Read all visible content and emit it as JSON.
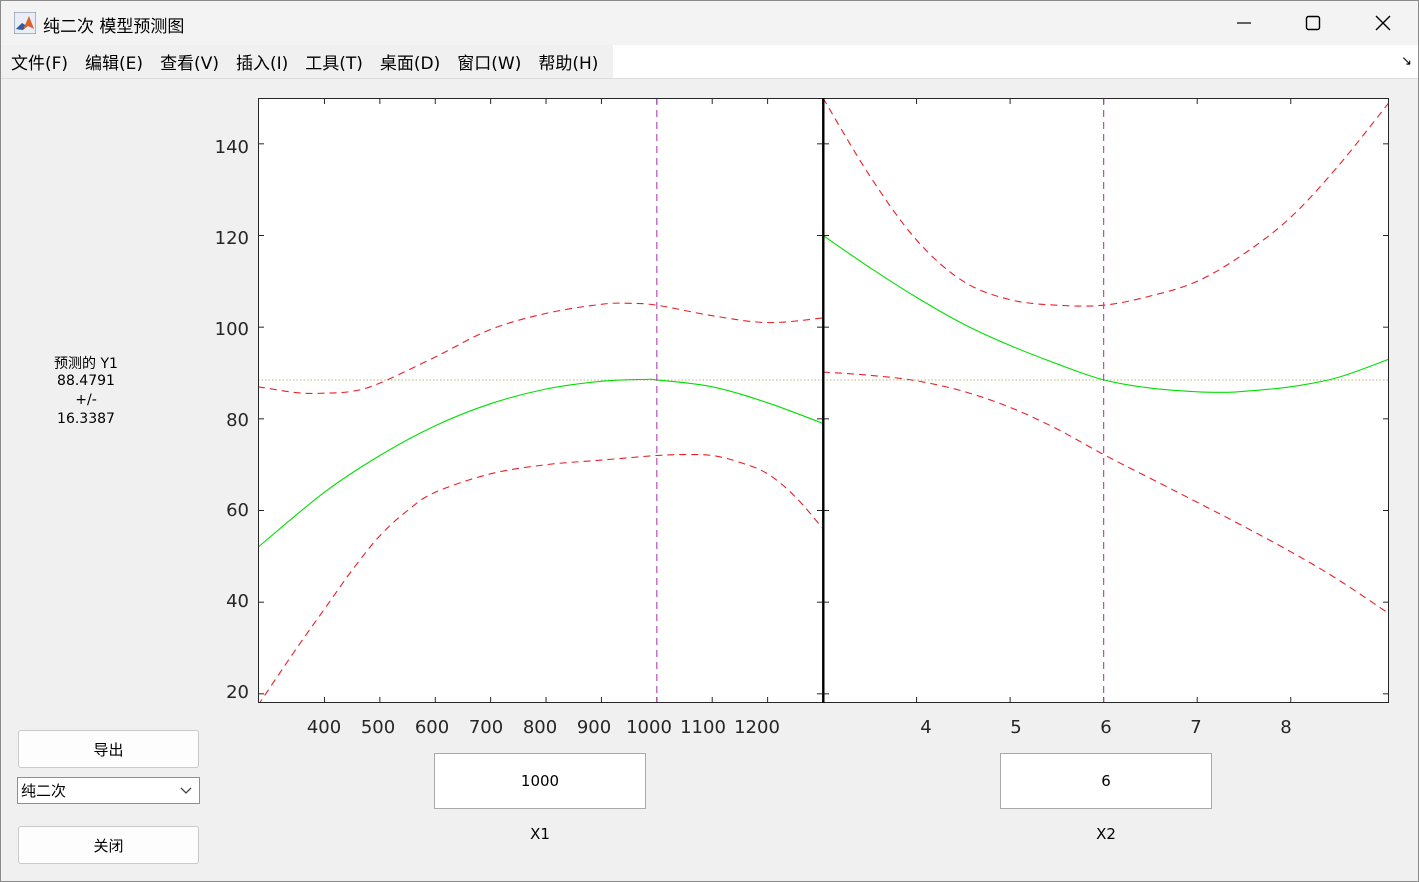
{
  "window": {
    "title": "纯二次 模型预测图",
    "icons": {
      "app": "matlab-icon",
      "minimize": "minimize-icon",
      "maximize": "maximize-icon",
      "close": "close-icon"
    }
  },
  "menu": {
    "items": [
      "文件(F)",
      "编辑(E)",
      "查看(V)",
      "插入(I)",
      "工具(T)",
      "桌面(D)",
      "窗口(W)",
      "帮助(H)"
    ],
    "dock_icon": "dock-arrow-icon",
    "dock_glyph": "↘"
  },
  "readout": {
    "label": "预测的 Y1",
    "value": "88.4791",
    "pm": "+/-",
    "ci": "16.3387"
  },
  "controls": {
    "export_label": "导出",
    "model_selected": "纯二次",
    "close_label": "关闭"
  },
  "colors": {
    "prediction": "#00e000",
    "bounds": "#e8202a",
    "cursor": "#b040b0",
    "reference": "#b8b070"
  },
  "chart_data": [
    {
      "type": "line",
      "x_var": "X1",
      "x_value": "1000",
      "xlim": [
        280,
        1300
      ],
      "ylim": [
        18,
        150
      ],
      "xticks": [
        400,
        500,
        600,
        700,
        800,
        900,
        1000,
        1100,
        1200
      ],
      "yticks": [
        20,
        40,
        60,
        80,
        100,
        120,
        140
      ],
      "y_reference": 88.4791,
      "cursor_x": 1000,
      "series": [
        {
          "role": "prediction",
          "x": [
            280,
            400,
            500,
            600,
            700,
            800,
            900,
            980,
            1000,
            1100,
            1200,
            1300
          ],
          "values": [
            52,
            64,
            72,
            78.5,
            83.3,
            86.5,
            88.2,
            88.6,
            88.5,
            87,
            83.5,
            79
          ]
        },
        {
          "role": "upper",
          "x": [
            280,
            350,
            400,
            450,
            500,
            600,
            700,
            800,
            900,
            950,
            1000,
            1100,
            1200,
            1300
          ],
          "values": [
            87,
            85.7,
            85.6,
            86,
            87.8,
            93.5,
            99.5,
            103,
            105,
            105.2,
            104.8,
            102.5,
            101,
            102
          ]
        },
        {
          "role": "lower",
          "x": [
            280,
            350,
            400,
            450,
            500,
            550,
            600,
            700,
            800,
            900,
            1000,
            1050,
            1100,
            1150,
            1200,
            1250,
            1300
          ],
          "values": [
            17.5,
            30,
            38.5,
            47,
            54.5,
            60,
            64,
            68,
            70,
            71,
            72,
            72.2,
            72,
            70.5,
            68,
            63,
            56
          ]
        }
      ]
    },
    {
      "type": "line",
      "x_var": "X2",
      "x_value": "6",
      "xlim": [
        3,
        9.05
      ],
      "ylim": [
        18,
        150
      ],
      "xticks": [
        4,
        5,
        6,
        7,
        8
      ],
      "y_reference": 88.4791,
      "cursor_x": 6,
      "series": [
        {
          "role": "prediction",
          "x": [
            3,
            3.5,
            4,
            4.5,
            5,
            5.5,
            6,
            6.5,
            7,
            7.3,
            7.5,
            8,
            8.5,
            9.05
          ],
          "values": [
            120,
            113,
            106.5,
            100.7,
            96,
            92,
            88.5,
            86.7,
            85.9,
            85.8,
            86,
            87,
            89,
            93
          ]
        },
        {
          "role": "upper",
          "x": [
            3,
            3.5,
            4,
            4.5,
            5,
            5.5,
            6,
            6.5,
            7,
            7.5,
            8,
            8.5,
            9.05
          ],
          "values": [
            150,
            133,
            119,
            110,
            106,
            104.8,
            104.8,
            106.8,
            110,
            116,
            124,
            135,
            149
          ]
        },
        {
          "role": "lower",
          "x": [
            3,
            3.5,
            4,
            4.5,
            5,
            5.5,
            6,
            6.5,
            7,
            7.5,
            8,
            8.5,
            9.05
          ],
          "values": [
            90.2,
            89.5,
            88.3,
            86,
            82.5,
            77.8,
            72.2,
            67,
            61.8,
            56.5,
            51,
            45,
            37.5
          ]
        }
      ]
    }
  ]
}
